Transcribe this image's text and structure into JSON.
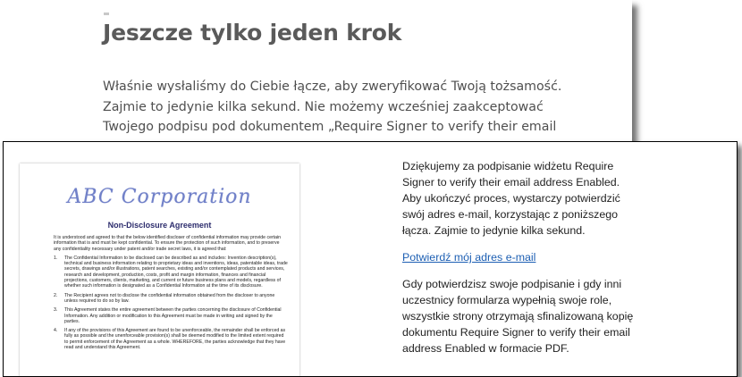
{
  "web_page": {
    "heading": "Jeszcze tylko jeden krok",
    "message": "Właśnie wysłaliśmy do Ciebie łącze, aby zweryfikować Twoją tożsamość. Zajmie to jedynie kilka sekund. Nie możemy wcześniej zaakceptować Twojego podpisu pod dokumentem „Require Signer to verify their email address Enabled”."
  },
  "email": {
    "intro": "Dziękujemy za podpisanie widżetu Require Signer to verify their email address Enabled. Aby ukończyć proces, wystarczy potwierdzić swój adres e-mail, korzystając z poniższego łącza. Zajmie to jedynie kilka sekund.",
    "confirm_link": "Potwierdź mój adres e-mail",
    "followup": "Gdy potwierdzisz swoje podpisanie i gdy inni uczestnicy formularza wypełnią swoje role, wszystkie strony otrzymają sfinalizowaną kopię dokumentu Require Signer to verify their email address Enabled w formacie PDF."
  },
  "document_preview": {
    "logo_text": "ABC Corporation",
    "title": "Non-Disclosure Agreement",
    "intro": "It is understood and agreed to that the below identified discloser of confidential information may provide certain information that is and must be kept confidential. To ensure the protection of such information, and to preserve any confidentiality necessary under patent and/or trade secret laws, it is agreed that:",
    "items": [
      {
        "num": "1.",
        "text": "The Confidential Information to be disclosed can be described as and includes: Invention description(s), technical and business information relating to proprietary ideas and inventions, ideas, patentable ideas, trade secrets, drawings and/or illustrations, patent searches, existing and/or contemplated products and services, research and development, production, costs, profit and margin information, finances and financial projections, customers, clients, marketing, and current or future business plans and models, regardless of whether such information is designated as a Confidential Information at the time of its disclosure."
      },
      {
        "num": "2.",
        "text": "The Recipient agrees not to disclose the confidential information obtained from the discloser to anyone unless required to do so by law."
      },
      {
        "num": "3.",
        "text": "This Agreement states the entire agreement between the parties concerning the disclosure of Confidential Information. Any addition or modification to this Agreement must be made in writing and signed by the parties."
      },
      {
        "num": "4.",
        "text": "If any of the provisions of this Agreement are found to be unenforceable, the remainder shall be enforced as fully as possible and the unenforceable provision(s) shall be deemed modified to the limited extent required to permit enforcement of the Agreement as a whole. WHEREFORE, the parties acknowledge that they have read and understand this Agreement."
      }
    ]
  }
}
